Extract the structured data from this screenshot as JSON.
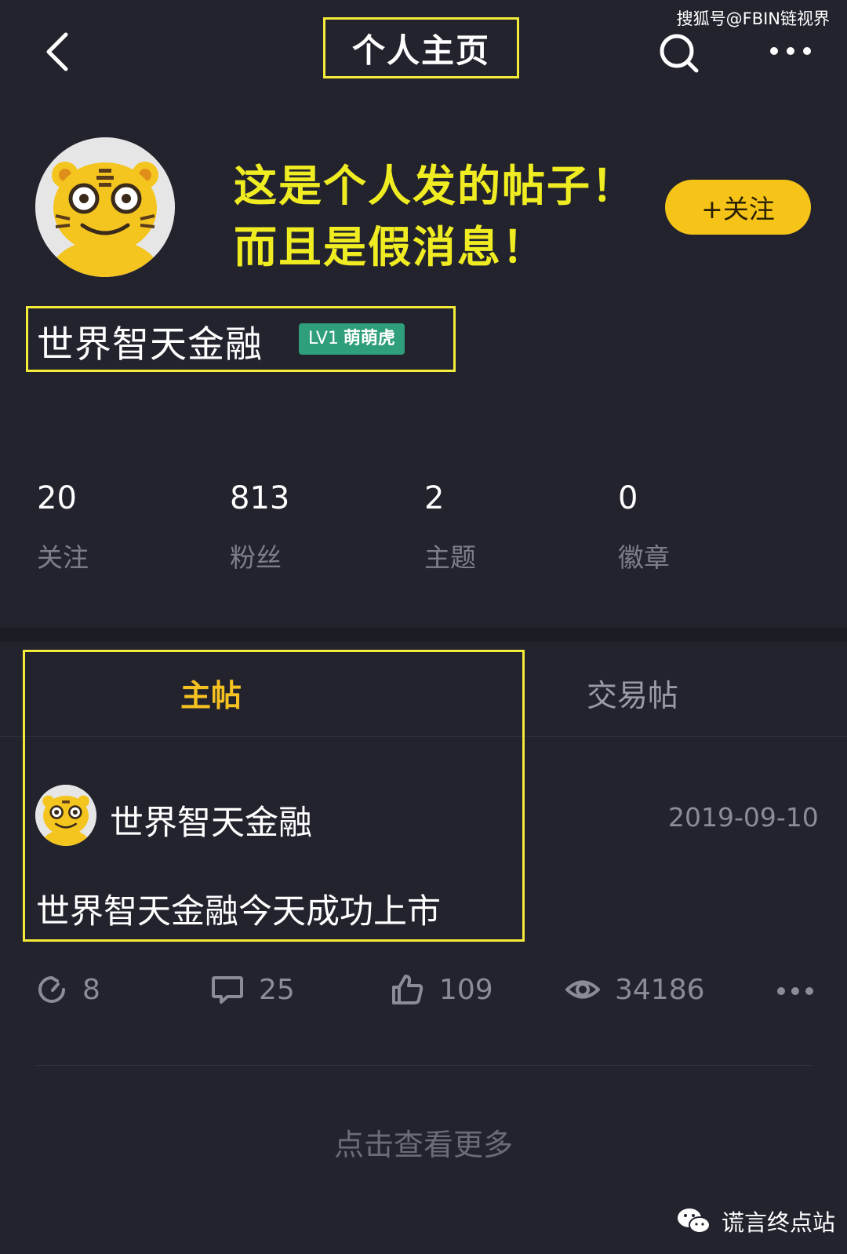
{
  "watermark_top": "搜狐号@FBIN链视界",
  "header": {
    "title": "个人主页"
  },
  "annotation": {
    "line1": "这是个人发的帖子！",
    "line2": "而且是假消息！"
  },
  "profile": {
    "name": "世界智天金融",
    "level": "LV1",
    "level_title": "萌萌虎",
    "follow_label": "+关注"
  },
  "stats": [
    {
      "value": "20",
      "label": "关注"
    },
    {
      "value": "813",
      "label": "粉丝"
    },
    {
      "value": "2",
      "label": "主题"
    },
    {
      "value": "0",
      "label": "徽章"
    }
  ],
  "tabs": [
    {
      "label": "主帖",
      "active": true
    },
    {
      "label": "交易帖",
      "active": false
    }
  ],
  "post": {
    "author": "世界智天金融",
    "date": "2019-09-10",
    "text": "世界智天金融今天成功上市",
    "actions": {
      "reposts": "8",
      "comments": "25",
      "likes": "109",
      "views": "34186"
    }
  },
  "load_more": "点击查看更多",
  "watermark_bottom": "谎言终点站",
  "colors": {
    "accent_yellow": "#f6c418",
    "highlight_box": "#f4ea3a",
    "badge_green": "#2f9e7b",
    "background": "#22232d"
  },
  "icons": [
    "back-icon",
    "search-icon",
    "more-icon",
    "repost-icon",
    "comment-icon",
    "like-icon",
    "eye-icon",
    "wechat-icon",
    "tiger-avatar"
  ]
}
